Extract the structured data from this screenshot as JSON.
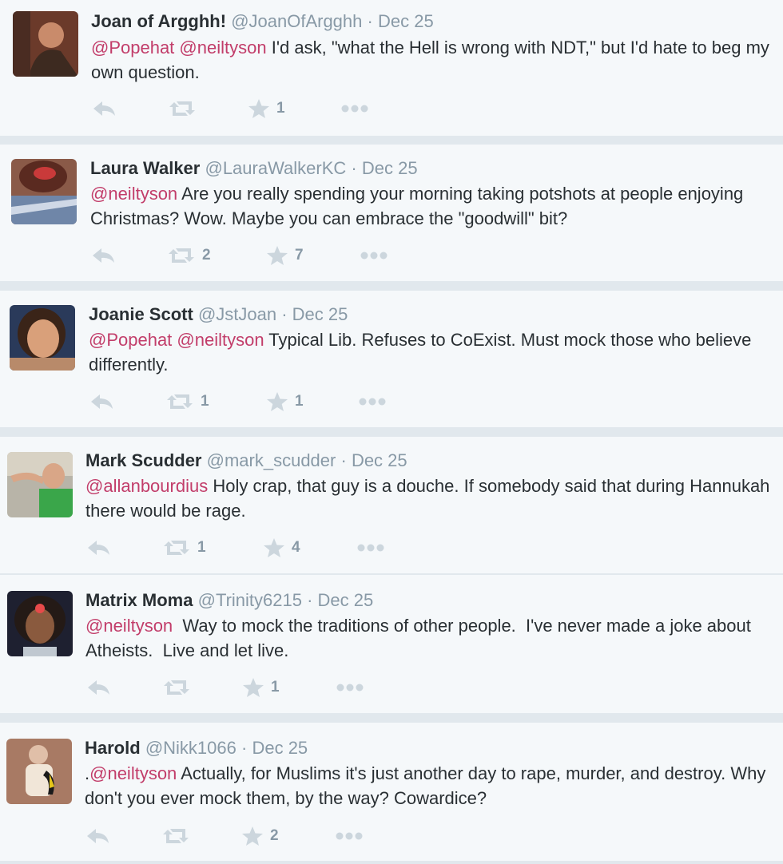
{
  "tweets": [
    {
      "name": "Joan of Argghh!",
      "handle": "@JoanOfArgghh",
      "sep": "·",
      "date": "Dec 25",
      "mentions": [
        "@Popehat",
        "@neiltyson"
      ],
      "text": " I'd ask, \"what the Hell is wrong with NDT,\" but I'd hate to beg my own question.",
      "retweets": "",
      "favorites": "1"
    },
    {
      "name": "Laura Walker",
      "handle": "@LauraWalkerKC",
      "sep": "·",
      "date": "Dec 25",
      "mentions": [
        "@neiltyson"
      ],
      "text": " Are you really spending your morning taking potshots at people enjoying Christmas? Wow. Maybe you can embrace the \"goodwill\" bit?",
      "retweets": "2",
      "favorites": "7"
    },
    {
      "name": "Joanie Scott",
      "handle": "@JstJoan",
      "sep": "·",
      "date": "Dec 25",
      "mentions": [
        "@Popehat",
        "@neiltyson"
      ],
      "text": " Typical Lib. Refuses to CoExist. Must mock those who believe differently.",
      "retweets": "1",
      "favorites": "1"
    },
    {
      "name": "Mark Scudder",
      "handle": "@mark_scudder",
      "sep": "·",
      "date": "Dec 25",
      "mentions": [
        "@allanbourdius"
      ],
      "text": " Holy crap, that guy is a douche. If somebody said that during Hannukah there would be rage.",
      "retweets": "1",
      "favorites": "4"
    },
    {
      "name": "Matrix Moma",
      "handle": "@Trinity6215",
      "sep": "·",
      "date": "Dec 25",
      "mentions": [
        "@neiltyson"
      ],
      "text": "  Way to mock the traditions of other people.  I've never made a joke about Atheists.  Live and let live.",
      "retweets": "",
      "favorites": "1"
    },
    {
      "name": "Harold",
      "handle": "@Nikk1066",
      "sep": "·",
      "date": "Dec 25",
      "prefix": ".",
      "mentions": [
        "@neiltyson"
      ],
      "text": " Actually, for Muslims it's just another day to rape, murder, and destroy. Why don't you ever mock them, by the way? Cowardice?",
      "retweets": "",
      "favorites": "2"
    }
  ],
  "icons": {
    "reply": "reply-icon",
    "retweet": "retweet-icon",
    "favorite": "star-icon",
    "more": "more-icon"
  },
  "colors": {
    "mention": "#c23d6a",
    "meta": "#8899a6",
    "icon": "#ccd6dd",
    "card": "#f5f8fa",
    "divider": "#e1e8ed"
  }
}
